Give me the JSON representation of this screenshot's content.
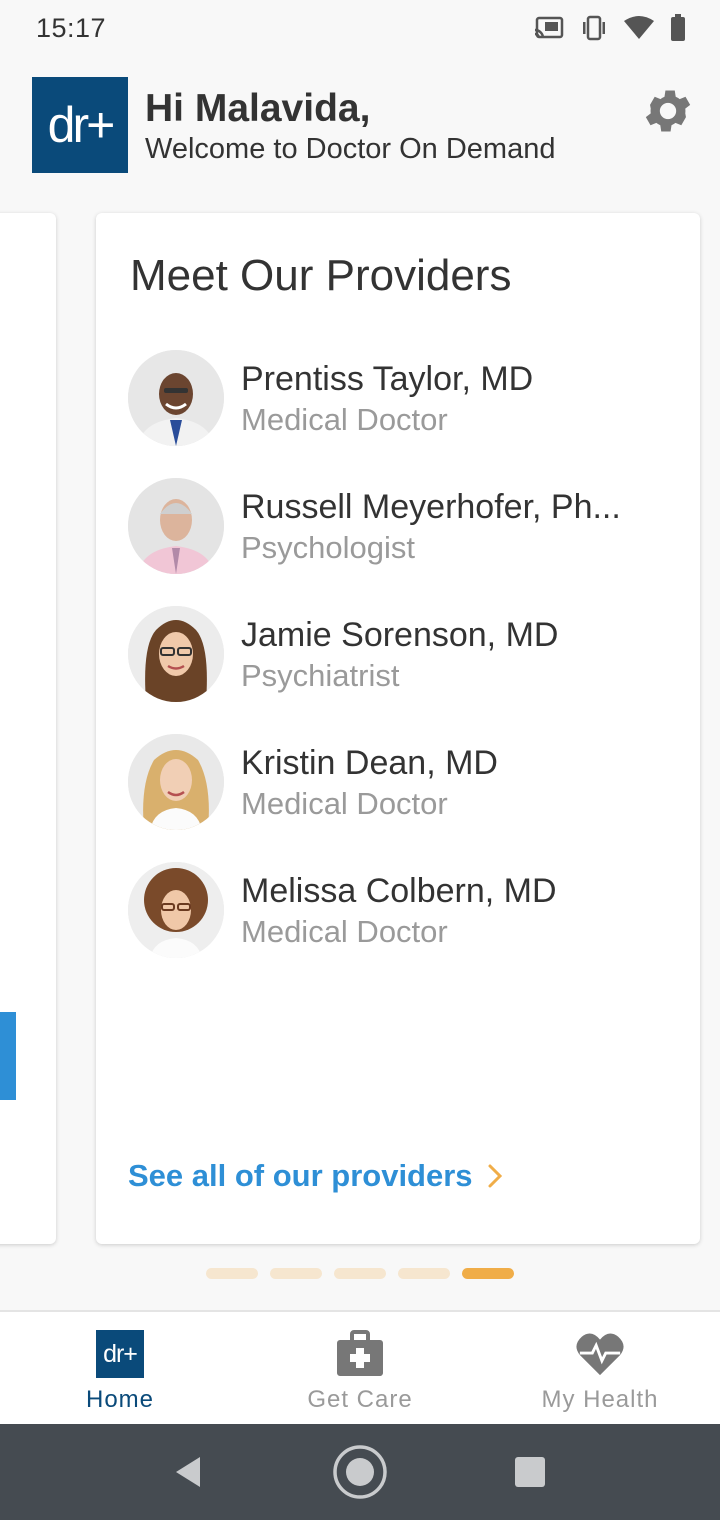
{
  "status_bar": {
    "time": "15:17",
    "icons": [
      "cast-icon",
      "vibrate-icon",
      "wifi-icon",
      "battery-icon"
    ]
  },
  "header": {
    "logo_text": "dr+",
    "greeting": "Hi Malavida,",
    "welcome": "Welcome to Doctor On Demand"
  },
  "card": {
    "title": "Meet Our Providers",
    "providers": [
      {
        "name": "Prentiss Taylor, MD",
        "title": "Medical Doctor"
      },
      {
        "name": "Russell Meyerhofer, Ph...",
        "title": "Psychologist"
      },
      {
        "name": "Jamie Sorenson, MD",
        "title": "Psychiatrist"
      },
      {
        "name": "Kristin Dean, MD",
        "title": "Medical Doctor"
      },
      {
        "name": "Melissa Colbern, MD",
        "title": "Medical Doctor"
      }
    ],
    "see_all_label": "See all of our providers"
  },
  "pager": {
    "count": 5,
    "active_index": 4
  },
  "bottom_nav": {
    "items": [
      {
        "label": "Home",
        "icon": "dr-logo-icon",
        "active": true
      },
      {
        "label": "Get Care",
        "icon": "medical-kit-icon",
        "active": false
      },
      {
        "label": "My Health",
        "icon": "heart-pulse-icon",
        "active": false
      }
    ]
  },
  "colors": {
    "brand": "#0a4a7a",
    "link": "#2e8fd6",
    "pager_active": "#f0ad48",
    "pager_inactive": "#f6e6cf"
  }
}
